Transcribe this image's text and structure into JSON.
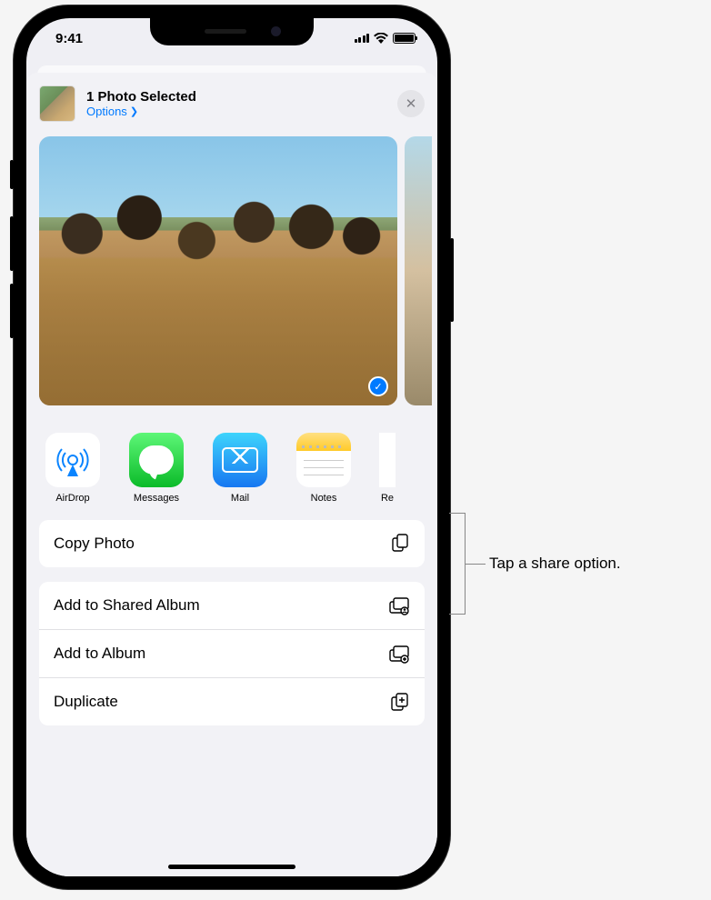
{
  "status": {
    "time": "9:41"
  },
  "header": {
    "title": "1 Photo Selected",
    "options_label": "Options"
  },
  "apps": [
    {
      "name": "AirDrop"
    },
    {
      "name": "Messages"
    },
    {
      "name": "Mail"
    },
    {
      "name": "Notes"
    },
    {
      "name": "Re"
    }
  ],
  "actions": {
    "copy": "Copy Photo",
    "shared_album": "Add to Shared Album",
    "album": "Add to Album",
    "duplicate": "Duplicate"
  },
  "callout": "Tap a share option."
}
